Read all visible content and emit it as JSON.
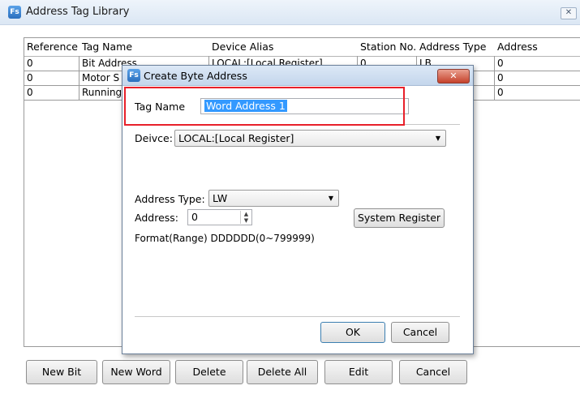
{
  "window": {
    "title": "Address Tag Library",
    "close_label": "✕"
  },
  "table": {
    "headers": [
      "Reference",
      "Tag Name",
      "Device Alias",
      "Station No.",
      "Address Type",
      "Address"
    ],
    "rows": [
      [
        "0",
        "Bit Address",
        "LOCAL:[Local Register]",
        "0",
        "LB",
        "0"
      ],
      [
        "0",
        "Motor S",
        "",
        "",
        "",
        "0"
      ],
      [
        "0",
        "Running",
        "",
        "",
        "",
        "0"
      ]
    ]
  },
  "buttons": {
    "new_bit": "New Bit",
    "new_word": "New Word",
    "delete": "Delete",
    "delete_all": "Delete All",
    "edit": "Edit",
    "cancel": "Cancel"
  },
  "dialog": {
    "title": "Create Byte Address",
    "close_label": "✕",
    "tag_name_label": "Tag Name",
    "tag_name_value": "Word Address 1",
    "device_label": "Deivce:",
    "device_value": "LOCAL:[Local Register]",
    "address_type_label": "Address Type:",
    "address_type_value": "LW",
    "address_label": "Address:",
    "address_value": "0",
    "system_register_label": "System Register",
    "format_text": "Format(Range) DDDDDD(0~799999)",
    "ok_label": "OK",
    "cancel_label": "Cancel"
  },
  "colors": {
    "highlight_box": "#e8202a",
    "selection": "#3399ff"
  }
}
